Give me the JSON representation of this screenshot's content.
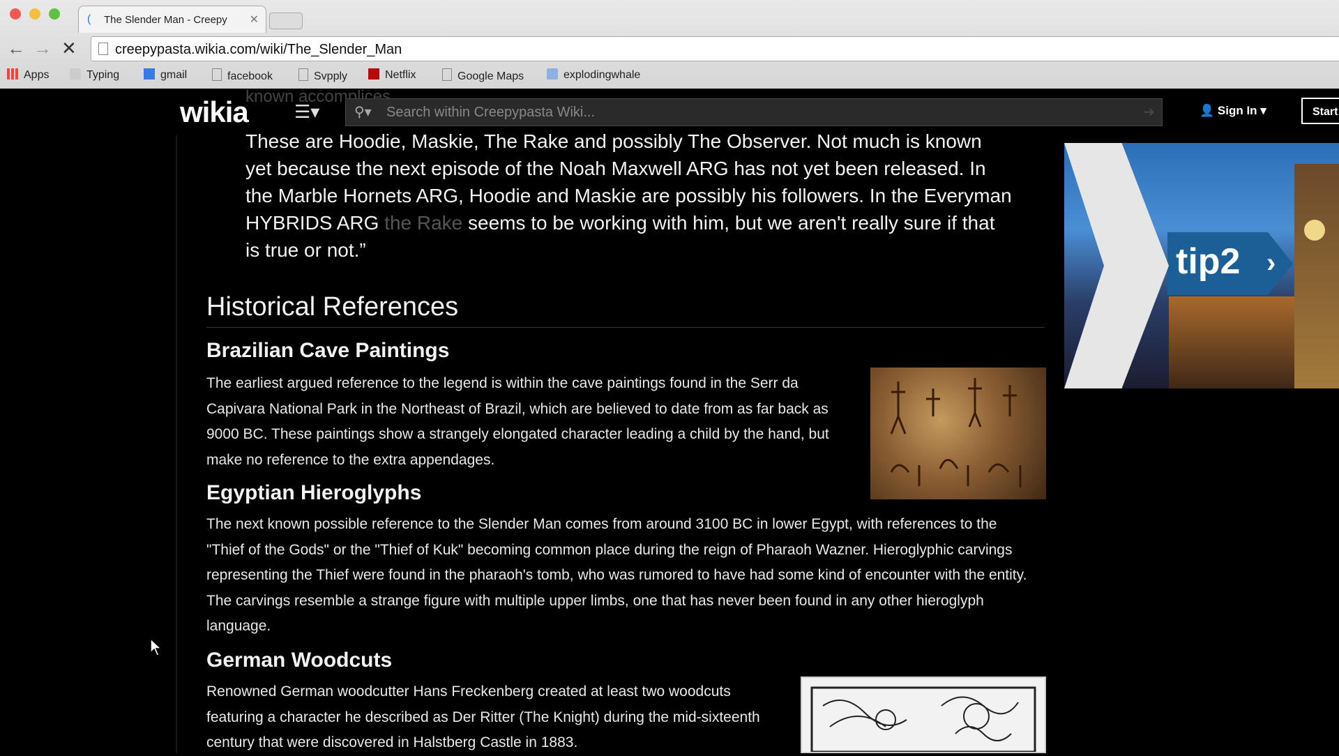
{
  "browser": {
    "tab_title": "The Slender Man - Creepy",
    "url": "creepypasta.wikia.com/wiki/The_Slender_Man",
    "bookmarks": [
      "Apps",
      "Typing",
      "gmail",
      "facebook",
      "Svpply",
      "Netflix",
      "Google Maps",
      "explodingwhale"
    ]
  },
  "wikia": {
    "logo": "wikia",
    "ghost_text": "known accomplices",
    "search_placeholder": "Search within Creepypasta Wiki...",
    "sign_in": "Sign In",
    "start": "Start"
  },
  "article": {
    "quote_pre": "These are Hoodie, Maskie, The Rake and possibly The Observer. Not much is known yet because the next episode of the Noah Maxwell ARG has not yet been released. In the Marble Hornets ARG, Hoodie and Maskie are possibly his followers. In the Everyman HYBRIDS ARG ",
    "quote_link": "the Rake",
    "quote_post": " seems to be working with him, but we aren't really sure if that is true or not.”",
    "section_title": "Historical References",
    "subsections": [
      {
        "title": "Brazilian Cave Paintings",
        "text": "The earliest argued reference to the legend is within the cave paintings found in the Serr da Capivara National Park in the Northeast of Brazil, which are believed to date from as far back as 9000 BC. These paintings show a strangely elongated character leading a child by the hand, but make no reference to the extra appendages."
      },
      {
        "title": "Egyptian Hieroglyphs",
        "text": "The next known possible reference to the Slender Man comes from around 3100 BC in lower Egypt, with references to the \"Thief of the Gods\" or the \"Thief of Kuk\" becoming common place during the reign of Pharaoh Wazner. Hieroglyphic carvings representing the Thief were found in the pharaoh's tomb, who was rumored to have had some kind of encounter with the entity. The carvings resemble a strange figure with multiple upper limbs, one that has never been found in any other hieroglyph language."
      },
      {
        "title": "German Woodcuts",
        "text": "Renowned German woodcutter Hans Freckenberg created at least two woodcuts featuring a character he described as Der Ritter (The Knight) during the mid-sixteenth century that were discovered in Halstberg Castle in 1883."
      }
    ]
  },
  "ad": {
    "text": "tip2",
    "arrow": "›"
  }
}
